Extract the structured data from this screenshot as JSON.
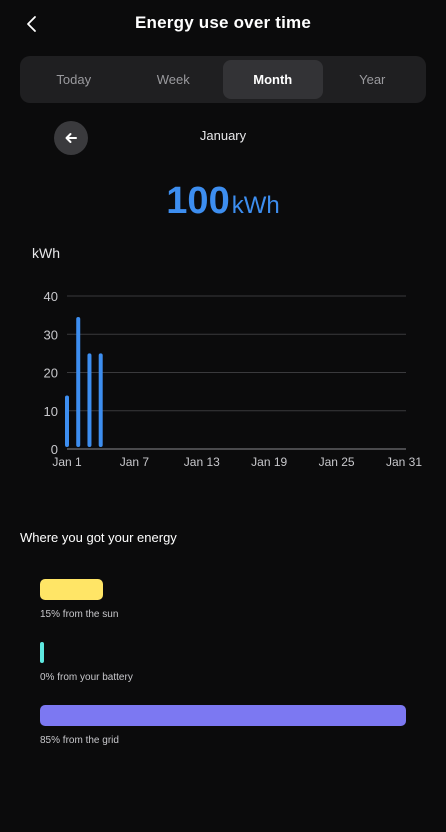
{
  "header": {
    "title": "Energy use over time",
    "back_icon": "chevron-left-icon"
  },
  "tabs": [
    {
      "label": "Today",
      "active": false
    },
    {
      "label": "Week",
      "active": false
    },
    {
      "label": "Month",
      "active": true
    },
    {
      "label": "Year",
      "active": false
    }
  ],
  "period": {
    "label": "January",
    "prev_icon": "arrow-left-icon"
  },
  "total": {
    "value": "100",
    "unit": "kWh"
  },
  "chart_data": {
    "type": "bar",
    "ylabel": "kWh",
    "ylim": [
      0,
      40
    ],
    "yticks": [
      0,
      10,
      20,
      30,
      40
    ],
    "xlim": [
      1,
      31
    ],
    "xticks": [
      1,
      7,
      13,
      19,
      25,
      31
    ],
    "xticklabels": [
      "Jan 1",
      "Jan 7",
      "Jan 13",
      "Jan 19",
      "Jan 25",
      "Jan 31"
    ],
    "x": [
      1,
      2,
      3,
      4
    ],
    "values": [
      14,
      34.5,
      25,
      25
    ],
    "bar_color": "#3d8ef0",
    "grid": true
  },
  "sources": {
    "title": "Where you got your energy",
    "items": [
      {
        "label": "15% from the sun",
        "fraction": 0.15,
        "color": "#ffe566"
      },
      {
        "label": "0% from your battery",
        "fraction": 0.0,
        "color": "#5ee8e0"
      },
      {
        "label": "85% from the grid",
        "fraction": 0.85,
        "color": "#7c78f2"
      }
    ]
  },
  "colors": {
    "background": "#0b0b0c",
    "accent": "#3d8ef0"
  }
}
